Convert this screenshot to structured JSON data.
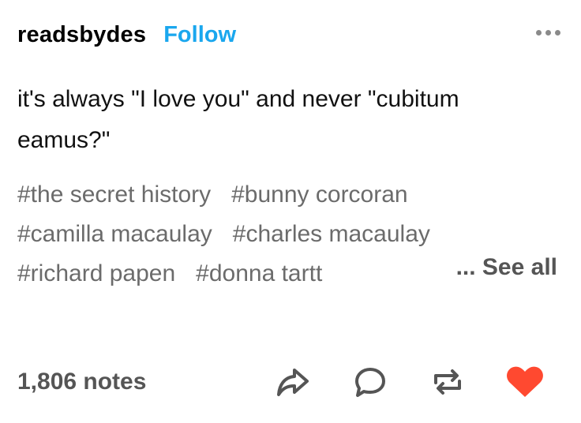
{
  "header": {
    "username": "readsbydes",
    "follow_label": "Follow",
    "more_icon": "more-horizontal-icon"
  },
  "post": {
    "text_line1": "it's always \"I love you\" and never \"cubitum",
    "text_line2": "eamus?\""
  },
  "tags": {
    "rows": [
      [
        "#the secret history",
        "#bunny corcoran"
      ],
      [
        "#camilla macaulay",
        "#charles macaulay"
      ],
      [
        "#richard papen",
        "#donna tartt"
      ]
    ],
    "see_all_label": "... See all"
  },
  "footer": {
    "notes_label": "1,806 notes",
    "icons": [
      "share-icon",
      "reply-icon",
      "reblog-icon",
      "like-icon"
    ],
    "like_color": "#ff4930",
    "icon_color": "#555555"
  },
  "colors": {
    "follow": "#1aa7ee",
    "tags": "#6b6b6b",
    "text": "#111111"
  }
}
